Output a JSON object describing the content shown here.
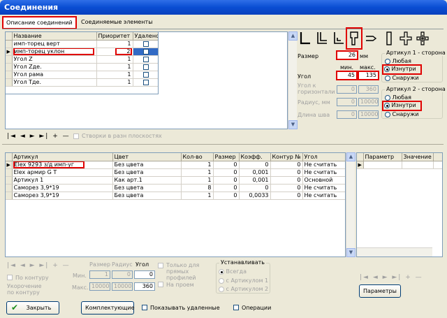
{
  "window": {
    "title": "Соединения"
  },
  "tabs": [
    {
      "label": "Описание соединений",
      "active": true
    },
    {
      "label": "Соединяемые элементы",
      "active": false
    }
  ],
  "top_grid": {
    "headers": [
      "Название",
      "Приоритет",
      "Удалено"
    ],
    "rows": [
      {
        "name": "имп-торец верт",
        "priority": "1",
        "deleted": false
      },
      {
        "name": "имп-торец уклон",
        "priority": "2",
        "deleted": false,
        "selected": true
      },
      {
        "name": "Угол Z",
        "priority": "1",
        "deleted": false
      },
      {
        "name": "Угол Zде.",
        "priority": "1",
        "deleted": false
      },
      {
        "name": "Угол рама",
        "priority": "1",
        "deleted": false
      },
      {
        "name": "Угол Tде.",
        "priority": "1",
        "deleted": false
      }
    ]
  },
  "top_nav": {
    "buttons": "|◄ ◄ ► ►| + —",
    "planes_label": "Створки в разн плоскостях"
  },
  "params": {
    "size_label": "Размер",
    "size_value": "26",
    "size_unit": "мм",
    "min_label": "мин.",
    "max_label": "макс.",
    "angle_label": "Угол",
    "angle_min": "45",
    "angle_max": "135",
    "horiz_label": "Угол к горизонтали",
    "horiz_min": "0",
    "horiz_max": "360",
    "radius_label": "Радиус, мм",
    "radius_min": "0",
    "radius_max": "10000",
    "seam_label": "Длина шва",
    "seam_min": "0",
    "seam_max": "10000"
  },
  "side1": {
    "title": "Артикул 1 - сторона",
    "options": [
      "Любая",
      "Изнутри",
      "Снаружи"
    ],
    "selected": 1
  },
  "side2": {
    "title": "Артикул 2 - сторона",
    "options": [
      "Любая",
      "Изнутри",
      "Снаружи"
    ],
    "selected": 1
  },
  "bottom_grid": {
    "headers": [
      "Артикул",
      "Цвет",
      "Кол-во",
      "Размер",
      "Коэфф.",
      "Контур №",
      "Угол"
    ],
    "rows": [
      {
        "art": "Elex 9293 з/д имп-уг",
        "color": "Без цвета",
        "qty": "1",
        "size": "0",
        "coef": "0",
        "contour": "0",
        "angle": "Не считать",
        "current": true
      },
      {
        "art": "Elex армир G T",
        "color": "Без цвета",
        "qty": "1",
        "size": "0",
        "coef": "0,001",
        "contour": "0",
        "angle": "Не считать"
      },
      {
        "art": "Артикул 1",
        "color": "Как арт.1",
        "qty": "1",
        "size": "0",
        "coef": "0,001",
        "contour": "0",
        "angle": "Основной"
      },
      {
        "art": "Саморез 3,9*19",
        "color": "Без цвета",
        "qty": "8",
        "size": "0",
        "coef": "0",
        "contour": "0",
        "angle": "Не считать"
      },
      {
        "art": "Саморез 3,9*19",
        "color": "Без цвета",
        "qty": "1",
        "size": "0",
        "coef": "0,0033",
        "contour": "0",
        "angle": "Не считать"
      }
    ]
  },
  "param_grid": {
    "headers": [
      "Параметр",
      "Значение"
    ]
  },
  "bottom_nav": {
    "buttons": "|◄ ◄ ► ►| + —"
  },
  "bottom_params": {
    "size_label": "Размер",
    "radius_label": "Радиус",
    "angle_label": "Угол",
    "min_label": "Мин.",
    "max_label": "Макс.",
    "min_size": "1",
    "min_radius": "0",
    "min_angle": "0",
    "max_size": "10000",
    "max_radius": "10000",
    "max_angle": "360",
    "contour_label": "По контуру",
    "shorten_label": "Укорочение по контуру",
    "straight_label": "Только для прямых профилей",
    "opening_label": "На проем"
  },
  "install": {
    "title": "Устанавливать",
    "options": [
      "Всегда",
      "с Артикулом 1",
      "с Артикулом 2"
    ],
    "selected": 0
  },
  "right_nav": {
    "buttons": "|◄ ◄ ► ►| + —"
  },
  "buttons": {
    "params": "Параметры",
    "close": "Закрыть",
    "kit": "Комплектующие",
    "show_deleted": "Показывать удаленные",
    "operations": "Операции"
  }
}
